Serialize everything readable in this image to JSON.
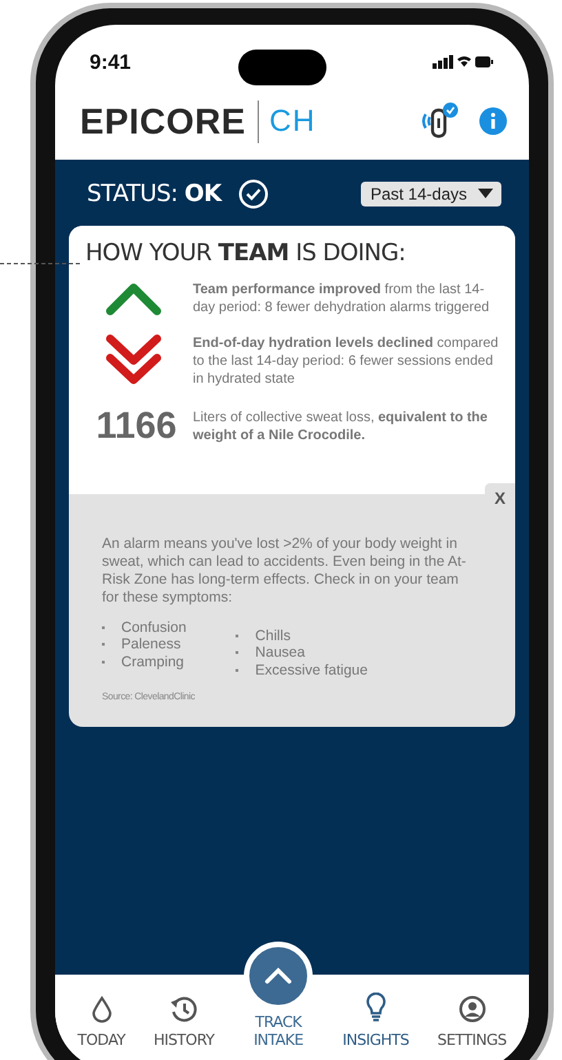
{
  "status_bar": {
    "time": "9:41"
  },
  "header": {
    "logo_main": "EPICORE",
    "logo_sub": "CH"
  },
  "status": {
    "label": "STATUS: **OK**",
    "checked": true,
    "period": "Past 14-days"
  },
  "team": {
    "title": "HOW YOUR **TEAM** IS DOING:",
    "items": [
      {
        "kind": "up",
        "text": "**Team performance improved** from the last 14-day period: 8 fewer dehydration alarms triggered"
      },
      {
        "kind": "down",
        "text": "**End-of-day hydration levels declined** compared to the last 14-day period: 6 fewer sessions ended in hydrated state"
      },
      {
        "kind": "stat",
        "value": "1166",
        "text": "Liters of collective sweat loss, **equivalent to the weight of a Nile Crocodile.**"
      }
    ]
  },
  "info": {
    "close": "X",
    "text": "An alarm means you've lost >2% of your body weight in sweat, which can lead to accidents. Even being in the At-Risk Zone has long-term effects. Check in on your team for these symptoms:",
    "symptoms_left": [
      "Confusion",
      "Paleness",
      "Cramping"
    ],
    "symptoms_right": [
      "Chills",
      "Nausea",
      "Excessive fatigue"
    ],
    "source": "Source: ClevelandClinic"
  },
  "nav": [
    {
      "kind": "tab",
      "label": "TODAY",
      "selected": false
    },
    {
      "kind": "tab",
      "label": "HISTORY",
      "selected": false
    },
    {
      "kind": "raised",
      "label": "TRACK INTAKE",
      "selected": false
    },
    {
      "kind": "tab",
      "label": "INSIGHTS",
      "selected": true
    },
    {
      "kind": "tab",
      "label": "SETTINGS",
      "selected": false
    }
  ]
}
